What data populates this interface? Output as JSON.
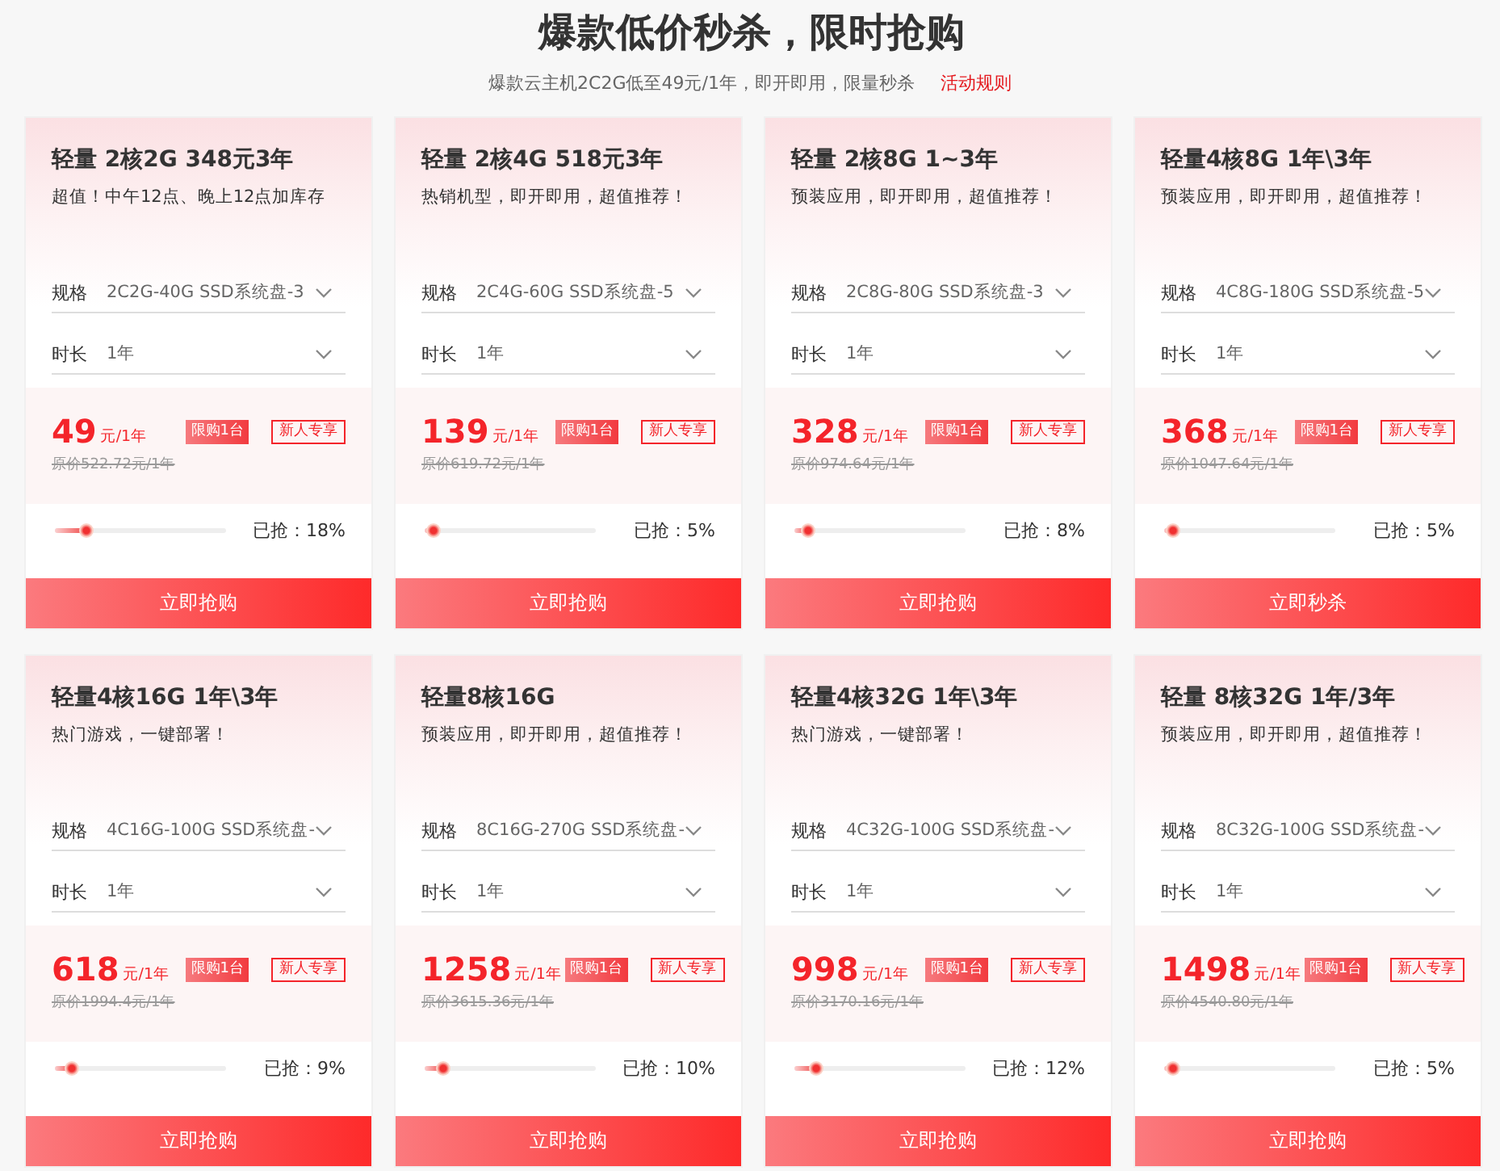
{
  "header": {
    "title": "爆款低价秒杀，限时抢购",
    "subtitle": "爆款云主机2C2G低至49元/1年，即开即用，限量秒杀",
    "rules_link": "活动规则"
  },
  "cards": [
    {
      "title": "轻量 2核2G 348元3年",
      "desc": "超值！中午12点、晚上12点加库存",
      "spec_label": "规格",
      "spec_value": "2C2G-40G SSD系统盘-3",
      "duration_label": "时长",
      "duration_value": "1年",
      "price": "49",
      "price_unit": "元/1年",
      "limit_tag": "限购1台",
      "new_tag": "新人专享",
      "original_price": "原价522.72元/1年",
      "sold_label": "已抢：18%",
      "level": 0.18,
      "button": "立即抢购"
    },
    {
      "title": "轻量 2核4G 518元3年",
      "desc": "热销机型，即开即用，超值推荐！",
      "spec_label": "规格",
      "spec_value": "2C4G-60G SSD系统盘-5",
      "duration_label": "时长",
      "duration_value": "1年",
      "price": "139",
      "price_unit": "元/1年",
      "limit_tag": "限购1台",
      "new_tag": "新人专享",
      "original_price": "原价619.72元/1年",
      "sold_label": "已抢：5%",
      "level": 0.05,
      "button": "立即抢购"
    },
    {
      "title": "轻量 2核8G 1~3年",
      "desc": "预装应用，即开即用，超值推荐！",
      "spec_label": "规格",
      "spec_value": "2C8G-80G SSD系统盘-3",
      "duration_label": "时长",
      "duration_value": "1年",
      "price": "328",
      "price_unit": "元/1年",
      "limit_tag": "限购1台",
      "new_tag": "新人专享",
      "original_price": "原价974.64元/1年",
      "sold_label": "已抢：8%",
      "level": 0.08,
      "button": "立即抢购"
    },
    {
      "title": "轻量4核8G 1年\\3年",
      "desc": "预装应用，即开即用，超值推荐！",
      "spec_label": "规格",
      "spec_value": "4C8G-180G SSD系统盘-5",
      "duration_label": "时长",
      "duration_value": "1年",
      "price": "368",
      "price_unit": "元/1年",
      "limit_tag": "限购1台",
      "new_tag": "新人专享",
      "original_price": "原价1047.64元/1年",
      "sold_label": "已抢：5%",
      "level": 0.05,
      "button": "立即秒杀"
    },
    {
      "title": "轻量4核16G 1年\\3年",
      "desc": "热门游戏，一键部署！",
      "spec_label": "规格",
      "spec_value": "4C16G-100G SSD系统盘-",
      "duration_label": "时长",
      "duration_value": "1年",
      "price": "618",
      "price_unit": "元/1年",
      "limit_tag": "限购1台",
      "new_tag": "新人专享",
      "original_price": "原价1994.4元/1年",
      "sold_label": "已抢：9%",
      "level": 0.09,
      "button": "立即抢购"
    },
    {
      "title": "轻量8核16G",
      "desc": "预装应用，即开即用，超值推荐！",
      "spec_label": "规格",
      "spec_value": "8C16G-270G SSD系统盘-",
      "duration_label": "时长",
      "duration_value": "1年",
      "price": "1258",
      "price_unit": "元/1年",
      "limit_tag": "限购1台",
      "new_tag": "新人专享",
      "original_price": "原价3615.36元/1年",
      "sold_label": "已抢：10%",
      "level": 0.1,
      "button": "立即抢购"
    },
    {
      "title": "轻量4核32G 1年\\3年",
      "desc": "热门游戏，一键部署！",
      "spec_label": "规格",
      "spec_value": "4C32G-100G SSD系统盘-",
      "duration_label": "时长",
      "duration_value": "1年",
      "price": "998",
      "price_unit": "元/1年",
      "limit_tag": "限购1台",
      "new_tag": "新人专享",
      "original_price": "原价3170.16元/1年",
      "sold_label": "已抢：12%",
      "level": 0.12,
      "button": "立即抢购"
    },
    {
      "title": "轻量 8核32G 1年/3年",
      "desc": "预装应用，即开即用，超值推荐！",
      "spec_label": "规格",
      "spec_value": "8C32G-100G SSD系统盘-",
      "duration_label": "时长",
      "duration_value": "1年",
      "price": "1498",
      "price_unit": "元/1年",
      "limit_tag": "限购1台",
      "new_tag": "新人专享",
      "original_price": "原价4540.80元/1年",
      "sold_label": "已抢：5%",
      "level": 0.05,
      "button": "立即抢购"
    }
  ]
}
